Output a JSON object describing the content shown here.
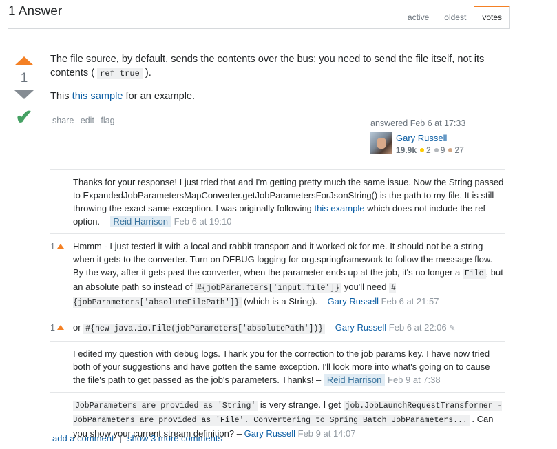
{
  "header": {
    "title": "1 Answer",
    "tabs": [
      "active",
      "oldest",
      "votes"
    ],
    "active_tab": "votes"
  },
  "votes": {
    "score": "1"
  },
  "answer": {
    "p1_a": "The file source, by default, sends the contents over the bus; you need to send the file itself, not its contents (",
    "p1_code": "ref=true",
    "p1_b": ").",
    "p2_a": "This",
    "p2_link": "this sample",
    "p2_b": "for an example."
  },
  "post_menu": [
    "share",
    "edit",
    "flag"
  ],
  "signature": {
    "action": "answered",
    "time": "Feb 6 at 17:33",
    "user": "Gary Russell",
    "reputation": "19.9k",
    "gold": "2",
    "silver": "9",
    "bronze": "27",
    "badge_colors": {
      "gold": "#ffcc01",
      "silver": "#b4b8bc",
      "bronze": "#d1a684"
    }
  },
  "comments": [
    {
      "score": "",
      "t1": "Thanks for your response! I just tried that and I'm getting pretty much the same issue. Now the String passed to ExpandedJobParametersMapConverter.getJobParametersForJsonString() is the path to my file. It is still throwing the exact same exception. I was originally following",
      "link": "this example",
      "t2": "which does not include the ref option. –",
      "user": "Reid Harrison",
      "date": "Feb 6 at 19:10"
    },
    {
      "score": "1",
      "t1": "Hmmm - I just tested it with a local and rabbit transport and it worked ok for me. It should not be a string when it gets to the converter. Turn on DEBUG logging for org.springframework to follow the message flow. By the way, after it gets past the converter, when the parameter ends up at the job, it's no longer a",
      "c1": "File",
      "t2": ", but an absolute path so instead of",
      "c2": "#{jobParameters['input.file']}",
      "t3": "you'll need",
      "c3": "#{jobParameters['absoluteFilePath']}",
      "t4": "(which is a String). –",
      "user": "Gary Russell",
      "date": "Feb 6 at 21:57"
    },
    {
      "score": "1",
      "t1": "or",
      "c1": "#{new java.io.File(jobParameters['absolutePath'])}",
      "t2": "–",
      "user": "Gary Russell",
      "date": "Feb 6 at 22:06"
    },
    {
      "score": "",
      "t1": "I edited my question with debug logs. Thank you for the correction to the job params key. I have now tried both of your suggestions and have gotten the same exception. I'll look more into what's going on to cause the file's path to get passed as the job's parameters. Thanks! –",
      "user": "Reid Harrison",
      "date": "Feb 9 at 7:38"
    },
    {
      "score": "",
      "c1": "JobParameters are provided as 'String'",
      "t1": "is very strange. I get",
      "c2": "job.JobLaunchRequestTransformer - JobParameters are provided as 'File'. Convertering to Spring Batch JobParameters...",
      "t2": ". Can you show your current stream definition? –",
      "user": "Gary Russell",
      "date": "Feb 9 at 14:07"
    }
  ],
  "comment_links": {
    "add": "add a comment",
    "sep": "|",
    "more": "show 3 more comments"
  }
}
